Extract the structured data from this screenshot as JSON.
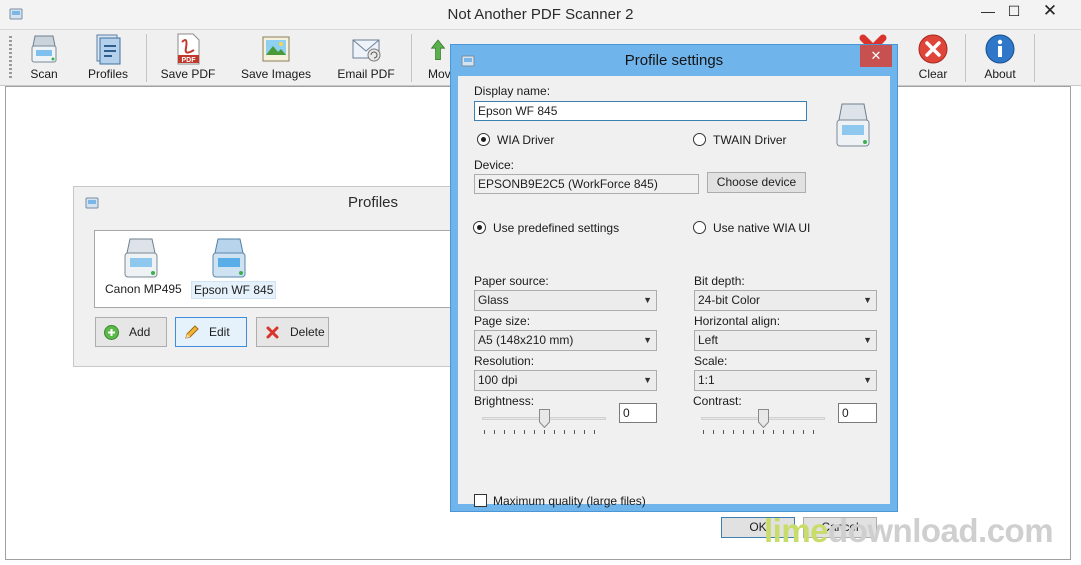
{
  "window": {
    "title": "Not Another PDF Scanner 2"
  },
  "toolbar": {
    "scan": "Scan",
    "profiles": "Profiles",
    "save_pdf": "Save PDF",
    "save_images": "Save Images",
    "email_pdf": "Email PDF",
    "move_partial": "Mov",
    "clear": "Clear",
    "about": "About"
  },
  "profiles_window": {
    "title": "Profiles",
    "items": [
      {
        "label": "Canon MP495"
      },
      {
        "label": "Epson WF 845",
        "selected": true
      }
    ],
    "buttons": {
      "add": "Add",
      "edit": "Edit",
      "delete": "Delete"
    }
  },
  "dialog": {
    "title": "Profile settings",
    "display_name_label": "Display name:",
    "display_name_value": "Epson WF 845",
    "driver_wia": "WIA Driver",
    "driver_twain": "TWAIN Driver",
    "driver_selected": "WIA Driver",
    "device_label": "Device:",
    "device_value": "EPSONB9E2C5 (WorkForce 845)",
    "choose_device": "Choose device",
    "mode_predefined": "Use predefined settings",
    "mode_native": "Use native WIA UI",
    "mode_selected": "Use predefined settings",
    "paper_source_label": "Paper source:",
    "paper_source_value": "Glass",
    "page_size_label": "Page size:",
    "page_size_value": "A5 (148x210 mm)",
    "resolution_label": "Resolution:",
    "resolution_value": "100 dpi",
    "brightness_label": "Brightness:",
    "brightness_value": "0",
    "bit_depth_label": "Bit depth:",
    "bit_depth_value": "24-bit Color",
    "horizontal_align_label": "Horizontal align:",
    "horizontal_align_value": "Left",
    "scale_label": "Scale:",
    "scale_value": "1:1",
    "contrast_label": "Contrast:",
    "contrast_value": "0",
    "max_quality_label": "Maximum quality (large files)",
    "max_quality_checked": false,
    "ok": "OK",
    "cancel": "Cancel"
  },
  "watermark": {
    "part_a": "lime",
    "part_b": "download.com"
  },
  "colors": {
    "dialog_frame": "#70b4ec",
    "close_red": "#c75050",
    "toolbar_bg": "#f0f0f0",
    "accent_blue": "#3c8fd6"
  }
}
